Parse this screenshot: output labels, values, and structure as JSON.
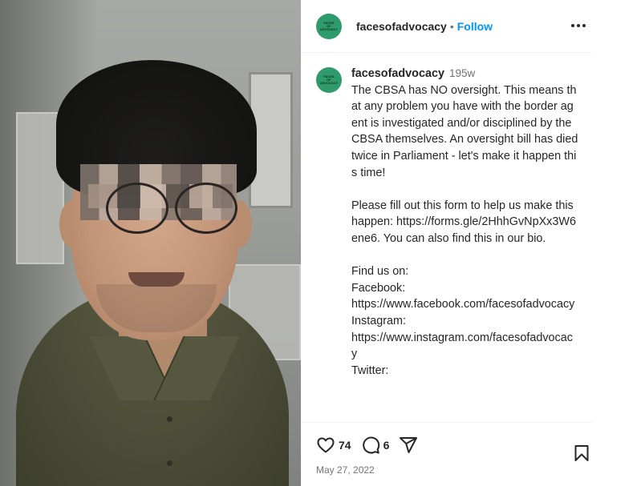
{
  "post": {
    "username": "facesofadvocacy",
    "separator": "•",
    "follow_label": "Follow",
    "avatar_text": [
      "FACES",
      "OF",
      "ADVOCACY"
    ]
  },
  "caption": {
    "username": "facesofadvocacy",
    "time": "195w",
    "paragraphs": [
      "The CBSA has NO oversight. This means that any problem you have with the border agent is investigated and/or disciplined by the CBSA themselves. An oversight bill has died twice in Parliament - let's make it happen this time!",
      "Please fill out this form to help us make this happen: https://forms.gle/2HhhGvNpXx3W6ene6. You can also find this in our bio.",
      "Find us on:\nFacebook:\nhttps://www.facebook.com/facesofadvocacy\nInstagram:\nhttps://www.instagram.com/facesofadvocacy\nTwitter:"
    ]
  },
  "actions": {
    "likes": "74",
    "comments": "6",
    "date": "May 27, 2022"
  },
  "icons": {
    "like": "heart-icon",
    "comment": "comment-icon",
    "share": "share-icon",
    "save": "bookmark-icon",
    "more": "more-options-icon"
  },
  "colors": {
    "follow": "#0095f6",
    "avatar_bg": "#2f9a6b",
    "text": "#262626",
    "muted": "#737373"
  }
}
